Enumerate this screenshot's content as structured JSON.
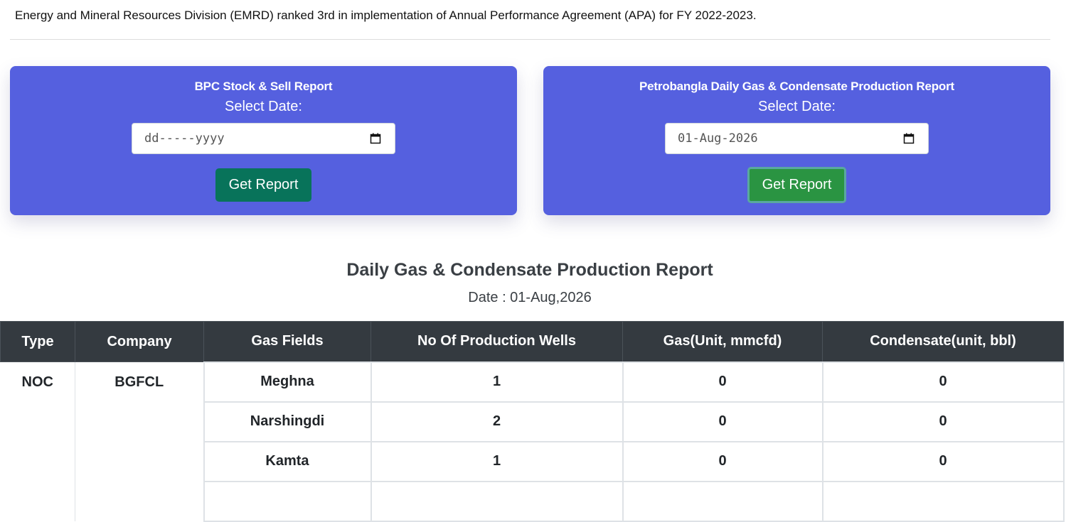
{
  "notice": "Energy and Mineral Resources Division (EMRD) ranked 3rd in implementation of Annual Performance Agreement (APA) for FY 2022-2023.",
  "cards": [
    {
      "title": "BPC Stock & Sell Report",
      "sub": "Select Date:",
      "date_value": "dd-----yyyy",
      "button": "Get Report"
    },
    {
      "title": "Petrobangla Daily Gas & Condensate Production Report",
      "sub": "Select Date:",
      "date_value": "01-Aug-2026",
      "button": "Get Report"
    }
  ],
  "report": {
    "title": "Daily Gas & Condensate Production Report",
    "date": "Date : 01-Aug,2026"
  },
  "table": {
    "headers": [
      "Type",
      "Company",
      "Gas Fields",
      "No Of Production Wells",
      "Gas(Unit, mmcfd)",
      "Condensate(unit, bbl)"
    ],
    "type": "NOC",
    "company": "BGFCL",
    "rows": [
      {
        "field": "Meghna",
        "wells": "1",
        "gas": "0",
        "condensate": "0"
      },
      {
        "field": "Narshingdi",
        "wells": "2",
        "gas": "0",
        "condensate": "0"
      },
      {
        "field": "Kamta",
        "wells": "1",
        "gas": "0",
        "condensate": "0"
      }
    ]
  },
  "colors": {
    "card_bg": "#5560df",
    "btn_teal": "#08735a",
    "btn_green": "#2a9442",
    "table_header": "#343a40"
  }
}
